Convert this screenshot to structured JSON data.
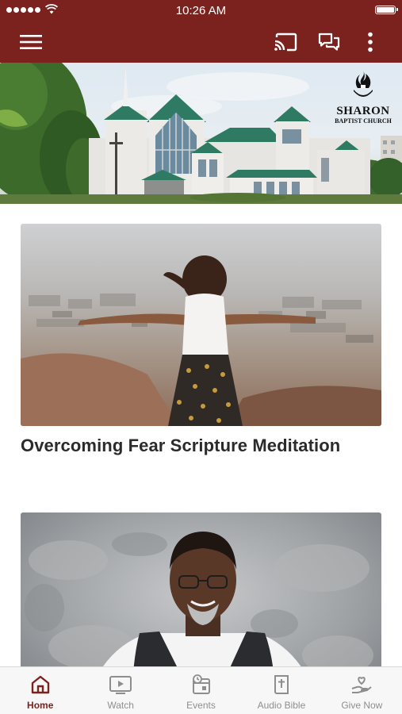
{
  "status_bar": {
    "time": "10:26 AM"
  },
  "header": {
    "logo": {
      "name": "SHARON",
      "subtitle": "BAPTIST CHURCH"
    }
  },
  "icons": {
    "menu": "hamburger-menu-icon",
    "cast": "cast-icon",
    "chat": "chat-icon",
    "more": "more-vertical-icon"
  },
  "feed": {
    "items": [
      {
        "title": "Overcoming Fear Scripture Meditation"
      },
      {
        "title": ""
      }
    ]
  },
  "tab_bar": {
    "tabs": [
      {
        "label": "Home",
        "icon": "home-icon",
        "active": true
      },
      {
        "label": "Watch",
        "icon": "play-icon",
        "active": false
      },
      {
        "label": "Events",
        "icon": "calendar-icon",
        "active": false
      },
      {
        "label": "Audio Bible",
        "icon": "bible-icon",
        "active": false
      },
      {
        "label": "Give Now",
        "icon": "give-icon",
        "active": false
      }
    ]
  },
  "colors": {
    "brand": "#7c221e",
    "active_tab": "#7c221e",
    "inactive_tab": "#8e8e8e"
  }
}
